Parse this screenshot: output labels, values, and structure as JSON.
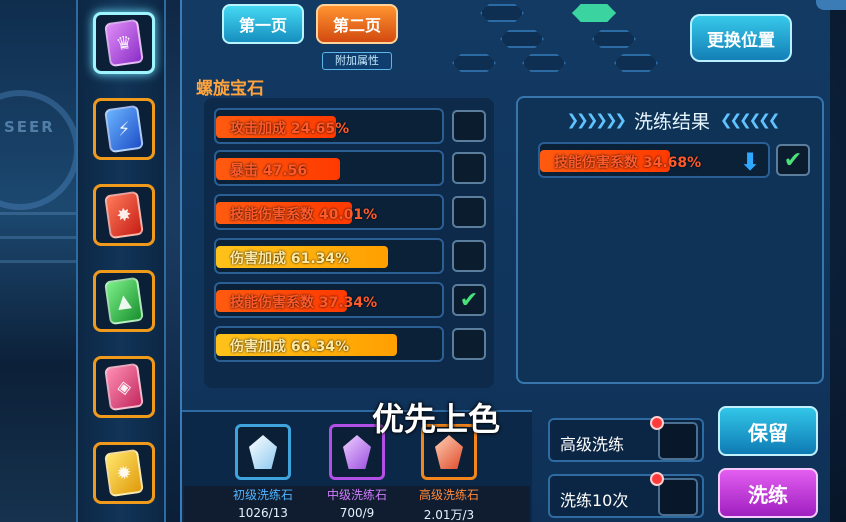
{
  "page_tabs": {
    "page1": "第一页",
    "page2": "第二页",
    "page2_tag": "附加属性"
  },
  "gem_name": "螺旋宝石",
  "swap_button": "更换位置",
  "gems": [
    {
      "color": "#b64bdc",
      "icon": "purple-gem-icon",
      "selected": true
    },
    {
      "color": "#2d6fe0",
      "icon": "blue-gem-icon",
      "selected": false
    },
    {
      "color": "#e53b2a",
      "icon": "red-gem-icon",
      "selected": false
    },
    {
      "color": "#27b34a",
      "icon": "green-gem-icon",
      "selected": false
    },
    {
      "color": "#e0497a",
      "icon": "pink-gem-icon",
      "selected": false
    },
    {
      "color": "#f2c21b",
      "icon": "yellow-gem-icon",
      "selected": false
    }
  ],
  "attributes": [
    {
      "name": "攻击加成",
      "value": "24.65%",
      "fill": 0.53,
      "tone": "orange",
      "checked": false
    },
    {
      "name": "暴击",
      "value": "47.56",
      "fill": 0.55,
      "tone": "orange",
      "checked": false
    },
    {
      "name": "技能伤害系数",
      "value": "40.01%",
      "fill": 0.6,
      "tone": "orange",
      "checked": false
    },
    {
      "name": "伤害加成",
      "value": "61.34%",
      "fill": 0.76,
      "tone": "gold",
      "checked": false
    },
    {
      "name": "技能伤害系数",
      "value": "37.34%",
      "fill": 0.58,
      "tone": "orange",
      "checked": true
    },
    {
      "name": "伤害加成",
      "value": "66.34%",
      "fill": 0.8,
      "tone": "gold",
      "checked": false
    }
  ],
  "result": {
    "title": "洗练结果",
    "arrows_left": "❯❯❯❯❯❯",
    "arrows_right": "❮❮❮❮❮❮",
    "name": "技能伤害系数",
    "value": "34.68%",
    "trend": "down",
    "checked": true
  },
  "stones": [
    {
      "label": "初级洗练石",
      "count": "1026/13",
      "label_color": "#4fb4ff",
      "crystal": "#bfe6ff"
    },
    {
      "label": "中级洗练石",
      "count": "700/9",
      "label_color": "#d07cff",
      "crystal": "#c88bff"
    },
    {
      "label": "高级洗练石",
      "count": "2.01万/3",
      "label_color": "#ff8a3a",
      "crystal": "#ff7a4a"
    }
  ],
  "overlay_caption": "优先上色",
  "options": {
    "advanced": "高级洗练",
    "ten_times": "洗练10次"
  },
  "buttons": {
    "keep": "保留",
    "wash": "洗练"
  }
}
